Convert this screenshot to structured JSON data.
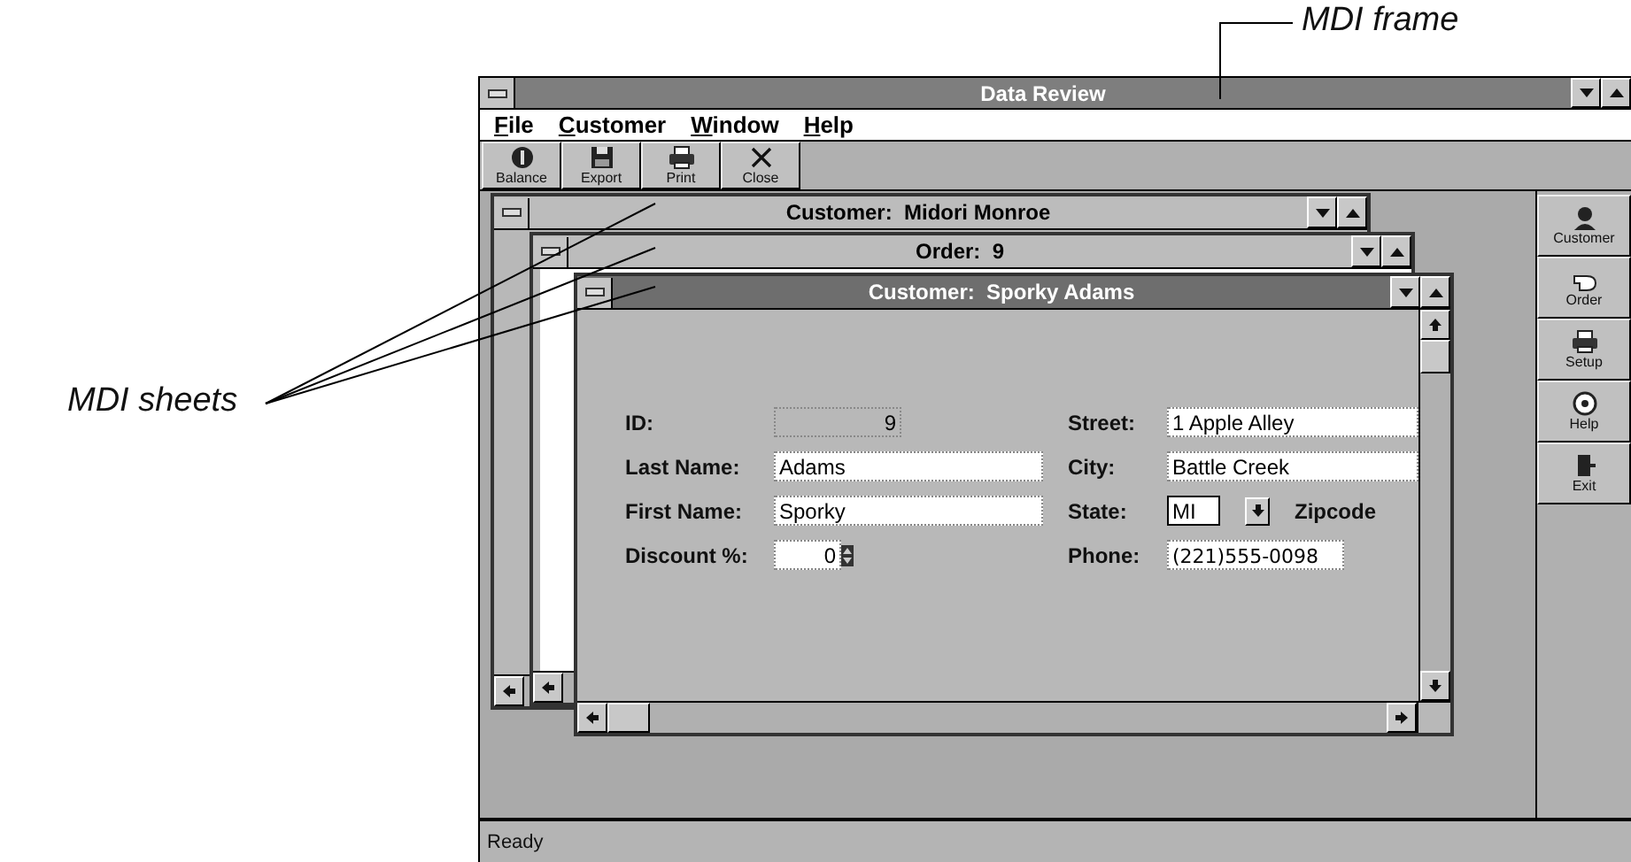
{
  "annotations": [
    {
      "text": "MDI frame"
    },
    {
      "text": "MDI sheets"
    }
  ],
  "window": {
    "title": "Data Review"
  },
  "menu": [
    {
      "label": "File"
    },
    {
      "label": "Customer"
    },
    {
      "label": "Window"
    },
    {
      "label": "Help"
    }
  ],
  "toolbar": [
    {
      "label": "Balance"
    },
    {
      "label": "Export"
    },
    {
      "label": "Print"
    },
    {
      "label": "Close"
    }
  ],
  "sheets": [
    {
      "title": "Customer:  Midori Monroe",
      "active": false
    },
    {
      "title": "Order:  9",
      "active": false
    },
    {
      "title": "Customer:  Sporky Adams",
      "active": true,
      "left_fields": [
        {
          "label": "ID:",
          "value": "9",
          "kind": "readonly"
        },
        {
          "label": "Last Name:",
          "value": "Adams",
          "kind": "text"
        },
        {
          "label": "First Name:",
          "value": "Sporky",
          "kind": "text"
        },
        {
          "label": "Discount %:",
          "value": "0",
          "kind": "spin"
        }
      ],
      "right_fields": [
        {
          "label": "Street:",
          "value": "1 Apple Alley",
          "kind": "text"
        },
        {
          "label": "City:",
          "value": "Battle Creek",
          "kind": "text"
        },
        {
          "label": "State:",
          "value": "MI",
          "kind": "dropdown",
          "next_label": "Zipcode"
        },
        {
          "label": "Phone:",
          "value": "(221)555-0098",
          "kind": "masked"
        }
      ]
    }
  ],
  "side_toolbar": [
    {
      "label": "Customer"
    },
    {
      "label": "Order"
    },
    {
      "label": "Setup"
    },
    {
      "label": "Help"
    },
    {
      "label": "Exit"
    }
  ],
  "status_bar": "Ready"
}
